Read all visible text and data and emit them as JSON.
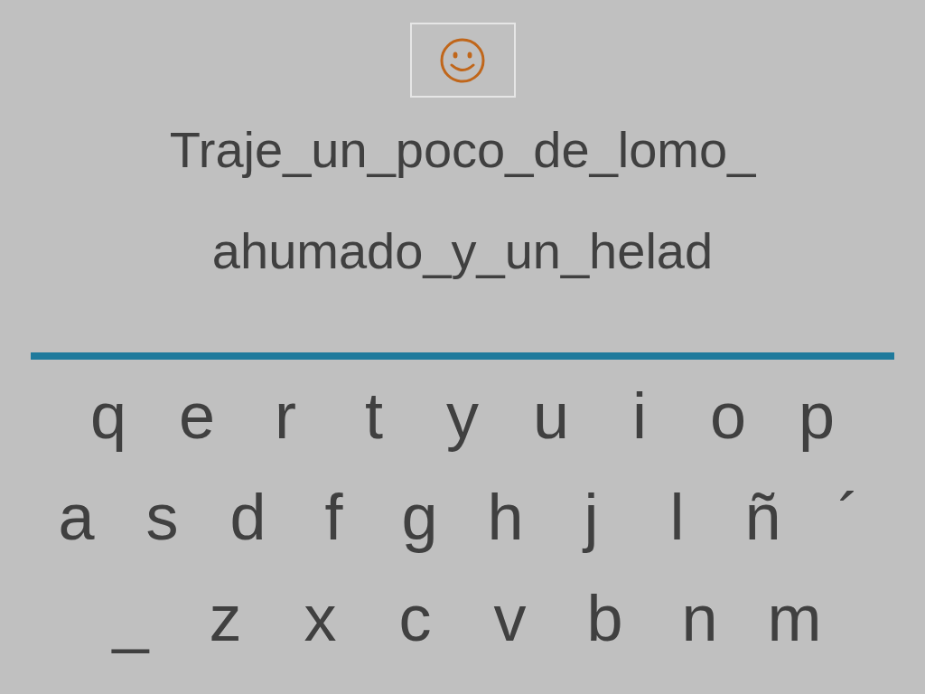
{
  "prompt_lines": [
    "Traje_un_poco_de_lomo_",
    "ahumado_y_un_helad"
  ],
  "keyboard_rows": [
    [
      "q",
      "e",
      "r",
      "t",
      "y",
      "u",
      "i",
      "o",
      "p"
    ],
    [
      "a",
      "s",
      "d",
      "f",
      "g",
      "h",
      "j",
      "l",
      "ñ",
      "´"
    ],
    [
      "_",
      "z",
      "x",
      "c",
      "v",
      "b",
      "n",
      "m"
    ]
  ]
}
